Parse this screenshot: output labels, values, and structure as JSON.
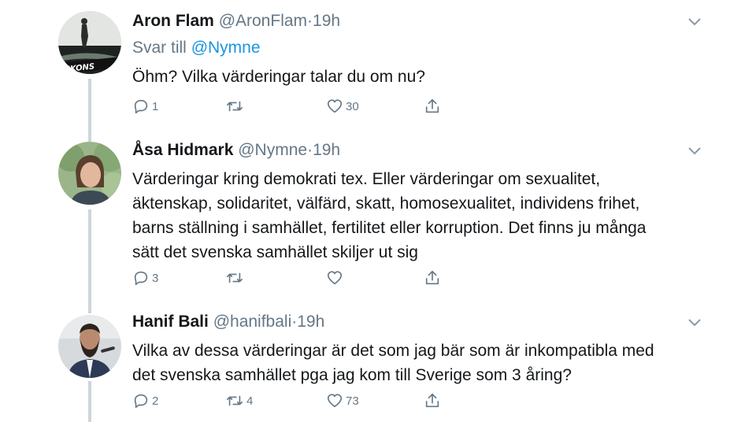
{
  "tweets": [
    {
      "name": "Aron Flam",
      "handle": "@AronFlam",
      "separator": "·",
      "time": "19h",
      "reply_prefix": "Svar till ",
      "reply_mention": "@Nymne",
      "text": "Öhm? Vilka värderingar talar du om nu?",
      "replies": "1",
      "retweets": "",
      "likes": "30",
      "avatar_icon": "avatar-aron-flam",
      "avatar_text": "EKONS"
    },
    {
      "name": "Åsa Hidmark",
      "handle": "@Nymne",
      "separator": "·",
      "time": "19h",
      "text_lines": [
        "Värderingar kring demokrati tex. Eller värderingar om sexualitet,",
        "äktenskap, solidaritet, välfärd, skatt, homosexualitet, individens frihet,",
        "barns ställning i samhället, fertilitet eller korruption. Det finns ju många",
        "sätt det svenska samhället skiljer ut sig"
      ],
      "replies": "3",
      "retweets": "",
      "likes": "",
      "avatar_icon": "avatar-asa-hidmark"
    },
    {
      "name": "Hanif Bali",
      "handle": "@hanifbali",
      "separator": "·",
      "time": "19h",
      "text_lines": [
        "Vilka av dessa värderingar är det som jag bär som är inkompatibla med",
        "det svenska samhället pga jag kom till Sverige som 3 åring?"
      ],
      "replies": "2",
      "retweets": "4",
      "likes": "73",
      "avatar_icon": "avatar-hanif-bali"
    }
  ],
  "icons": {
    "reply": "reply-icon",
    "retweet": "retweet-icon",
    "like": "heart-icon",
    "share": "share-icon",
    "menu": "chevron-down-icon"
  },
  "colors": {
    "text": "#14171a",
    "secondary": "#657786",
    "link": "#1b95e0",
    "thread": "#ccd6dd"
  }
}
